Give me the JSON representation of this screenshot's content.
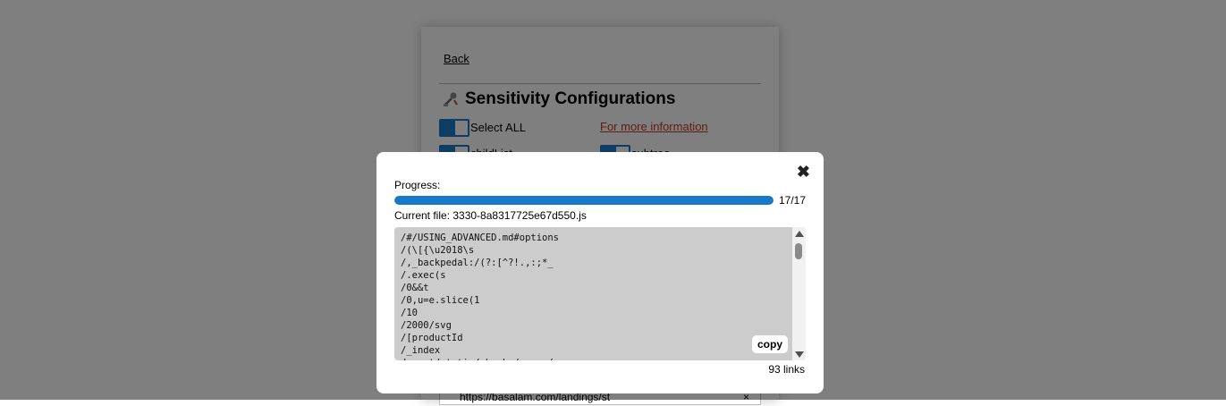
{
  "background": {
    "back_link": "Back",
    "title": "Sensitivity Configurations",
    "select_all_label": "Select ALL",
    "info_link": "For more information",
    "option_left": "childList",
    "option_right": "subtree",
    "url_item": "https://basalam.com/landings/st",
    "url_close": "×"
  },
  "modal": {
    "close_label": "✖",
    "progress_label": "Progress:",
    "progress_fraction": 1.0,
    "progress_count": "17/17",
    "current_file": "Current file: 3330-8a8317725e67d550.js",
    "code_lines": [
      "/#/USING_ADVANCED.md#options",
      "/(\\[{\\u2018\\s",
      "/,_backpedal:/(?:[^?!.,:;*_",
      "/.exec(s",
      "/0&&t",
      "/0,u=e.slice(1",
      "/10",
      "/2000/svg",
      "/[productId",
      "/_index",
      "/_next/static/chunks/pages/"
    ],
    "copy_label": "copy",
    "links_count": "93 links"
  },
  "colors": {
    "accent": "#1a78c8",
    "code_bg": "#cccccc",
    "link_red": "#c0392b"
  }
}
